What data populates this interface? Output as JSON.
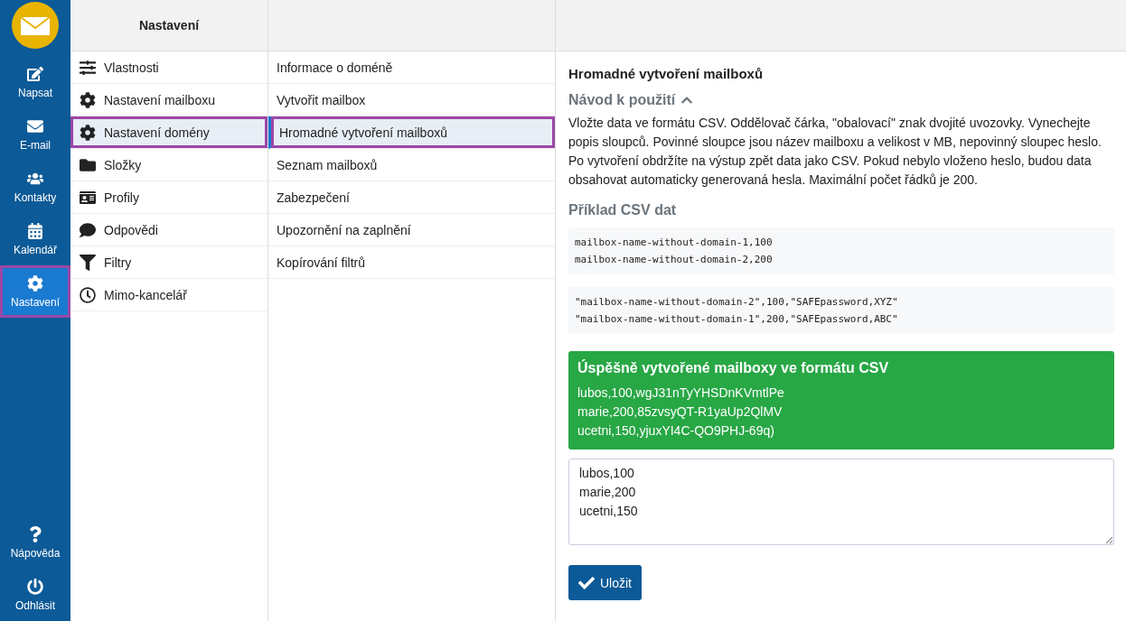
{
  "nav": {
    "items": [
      {
        "label": "Napsat",
        "selected": false
      },
      {
        "label": "E-mail",
        "selected": false
      },
      {
        "label": "Kontakty",
        "selected": false
      },
      {
        "label": "Kalendář",
        "selected": false
      },
      {
        "label": "Nastavení",
        "selected": true
      }
    ],
    "bottom_items": [
      {
        "label": "Nápověda"
      },
      {
        "label": "Odhlásit"
      }
    ]
  },
  "settings_menu": {
    "title": "Nastavení",
    "items": [
      {
        "label": "Vlastnosti",
        "selected": false
      },
      {
        "label": "Nastavení mailboxu",
        "selected": false
      },
      {
        "label": "Nastavení domény",
        "selected": true
      },
      {
        "label": "Složky",
        "selected": false
      },
      {
        "label": "Profily",
        "selected": false
      },
      {
        "label": "Odpovědi",
        "selected": false
      },
      {
        "label": "Filtry",
        "selected": false
      },
      {
        "label": "Mimo-kancelář",
        "selected": false
      }
    ]
  },
  "domain_menu": {
    "items": [
      {
        "label": "Informace o doméně",
        "selected": false
      },
      {
        "label": "Vytvořit mailbox",
        "selected": false
      },
      {
        "label": "Hromadné vytvoření mailboxů",
        "selected": true
      },
      {
        "label": "Seznam mailboxů",
        "selected": false
      },
      {
        "label": "Zabezpečení",
        "selected": false
      },
      {
        "label": "Upozornění na zaplnění",
        "selected": false
      },
      {
        "label": "Kopírování filtrů",
        "selected": false
      }
    ]
  },
  "content": {
    "title": "Hromadné vytvoření mailboxů",
    "help": {
      "title": "Návod k použití",
      "expanded": true,
      "text": "Vložte data ve formátu CSV. Oddělovač čárka, \"obalovací\" znak dvojité uvozovky. Vynechejte popis sloupců. Povinné sloupce jsou název mailboxu a velikost v MB, nepovinný sloupec heslo. Po vytvoření obdržíte na výstup zpět data jako CSV. Pokud nebylo vloženo heslo, budou data obsahovat automaticky generovaná hesla. Maximální počet řádků je 200."
    },
    "example_title": "Příklad CSV dat",
    "examples": [
      [
        "mailbox-name-without-domain-1,100",
        "mailbox-name-without-domain-2,200"
      ],
      [
        "\"mailbox-name-without-domain-2\",100,\"SAFEpassword,XYZ\"",
        "\"mailbox-name-without-domain-1\",200,\"SAFEpassword,ABC\""
      ]
    ],
    "result": {
      "title": "Úspěšně vytvořené mailboxy ve formátu CSV",
      "lines": [
        "lubos,100,wgJ31nTyYHSDnKVmtlPe",
        "marie,200,85zvsyQT-R1yaUp2QlMV",
        "ucetni,150,yjuxYI4C-QO9PHJ-69q)"
      ]
    },
    "input": {
      "value": "lubos,100\nmarie,200\nucetni,150"
    },
    "save_button": "Uložit"
  }
}
